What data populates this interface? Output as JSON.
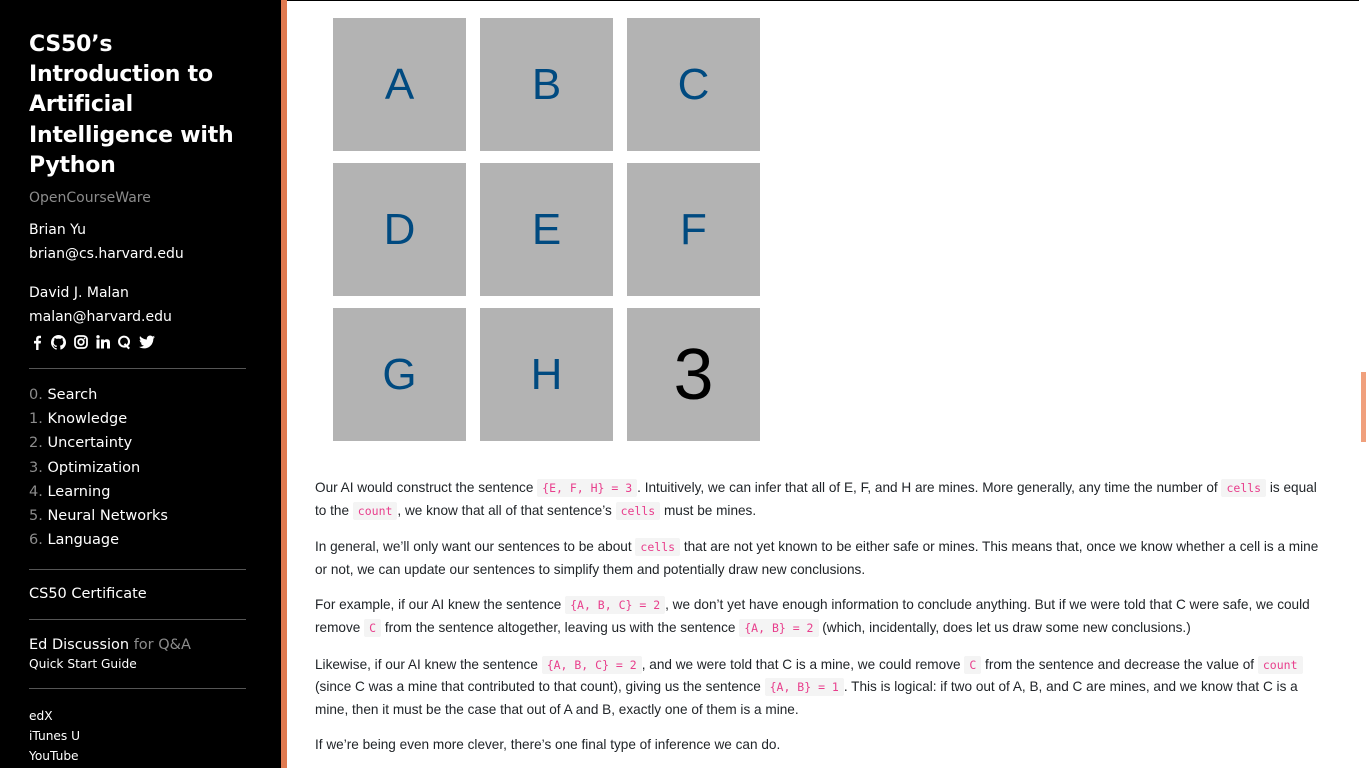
{
  "sidebar": {
    "title": "CS50’s Introduction to Artificial Intelligence with Python",
    "subtitle": "OpenCourseWare",
    "authors": [
      {
        "name": "Brian Yu",
        "email": "brian@cs.harvard.edu"
      },
      {
        "name": "David J. Malan",
        "email": "malan@harvard.edu"
      }
    ],
    "social_icons": [
      "facebook-icon",
      "github-icon",
      "instagram-icon",
      "linkedin-icon",
      "quora-icon",
      "twitter-icon"
    ],
    "nav": [
      {
        "num": "0.",
        "label": "Search"
      },
      {
        "num": "1.",
        "label": "Knowledge"
      },
      {
        "num": "2.",
        "label": "Uncertainty"
      },
      {
        "num": "3.",
        "label": "Optimization"
      },
      {
        "num": "4.",
        "label": "Learning"
      },
      {
        "num": "5.",
        "label": "Neural Networks"
      },
      {
        "num": "6.",
        "label": "Language"
      }
    ],
    "certificate": "CS50 Certificate",
    "ed_discussion": "Ed Discussion",
    "ed_suffix": "for Q&A",
    "quick_start": "Quick Start Guide",
    "links": [
      "edX",
      "iTunes U",
      "YouTube"
    ]
  },
  "grid": {
    "cells": [
      "A",
      "B",
      "C",
      "D",
      "E",
      "F",
      "G",
      "H",
      "3"
    ]
  },
  "paragraphs": {
    "p1": {
      "t1": "Our AI would construct the sentence ",
      "c1": "{E, F, H} = 3",
      "t2": ". Intuitively, we can infer that all of E, F, and H are mines. More generally, any time the number of ",
      "c2": "cells",
      "t3": " is equal to the ",
      "c3": "count",
      "t4": ", we know that all of that sentence’s ",
      "c4": "cells",
      "t5": " must be mines."
    },
    "p2": {
      "t1": "In general, we’ll only want our sentences to be about ",
      "c1": "cells",
      "t2": " that are not yet known to be either safe or mines. This means that, once we know whether a cell is a mine or not, we can update our sentences to simplify them and potentially draw new conclusions."
    },
    "p3": {
      "t1": "For example, if our AI knew the sentence ",
      "c1": "{A, B, C} = 2",
      "t2": ", we don’t yet have enough information to conclude anything. But if we were told that C were safe, we could remove ",
      "c2": "C",
      "t3": " from the sentence altogether, leaving us with the sentence ",
      "c3": "{A, B} = 2",
      "t4": " (which, incidentally, does let us draw some new conclusions.)"
    },
    "p4": {
      "t1": "Likewise, if our AI knew the sentence ",
      "c1": "{A, B, C} = 2",
      "t2": ", and we were told that C is a mine, we could remove ",
      "c2": "C",
      "t3": " from the sentence and decrease the value of ",
      "c3": "count",
      "t4": " (since C was a mine that contributed to that count), giving us the sentence ",
      "c4": "{A, B} = 1",
      "t5": ". This is logical: if two out of A, B, and C are mines, and we know that C is a mine, then it must be the case that out of A and B, exactly one of them is a mine."
    },
    "p5": {
      "t1": "If we’re being even more clever, there’s one final type of inference we can do."
    }
  },
  "colors": {
    "sidebar_bg": "#000000",
    "accent": "#e07a50",
    "cell_bg": "#b3b3b3",
    "cell_letter": "#004a80",
    "code": "#e83e8c"
  }
}
